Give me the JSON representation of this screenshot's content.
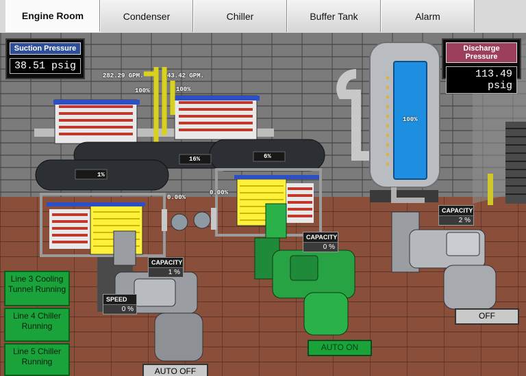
{
  "tabs": [
    "Engine Room",
    "Condenser",
    "Chiller",
    "Buffer Tank",
    "Alarm"
  ],
  "suction": {
    "label": "Suction Pressure",
    "value": "38.51 psig"
  },
  "discharge": {
    "label": "Discharge Pressure",
    "value": "113.49 psig"
  },
  "flows": [
    {
      "gpm": "282.29 GPM.",
      "pct": "100%"
    },
    {
      "gpm": "43.42 GPM.",
      "pct": "100%"
    }
  ],
  "tank_level": "100%",
  "vessel_levels": {
    "left": "1%",
    "middle": "16%",
    "right": "6%"
  },
  "pump_values": {
    "p1": "0.00%",
    "p2": "0.00%"
  },
  "compressors": {
    "left": {
      "capacity_label": "CAPACITY",
      "capacity": "1 %",
      "speed_label": "SPEED",
      "speed": "0 %",
      "mode": "AUTO OFF"
    },
    "middle": {
      "capacity_label": "CAPACITY",
      "capacity": "0 %",
      "mode": "AUTO ON"
    },
    "right": {
      "capacity_label": "CAPACITY",
      "capacity": "2 %",
      "mode": "OFF"
    }
  },
  "status_panels": [
    "Line 3 Cooling Tunnel Running",
    "Line 4 Chiller Running",
    "Line 5 Chiller Running"
  ],
  "colors": {
    "status_green": "#19a33a",
    "tank_blue": "#1e8fe0",
    "pipe_yellow": "#d8d21e",
    "hx_blue": "#2a4fc7"
  }
}
